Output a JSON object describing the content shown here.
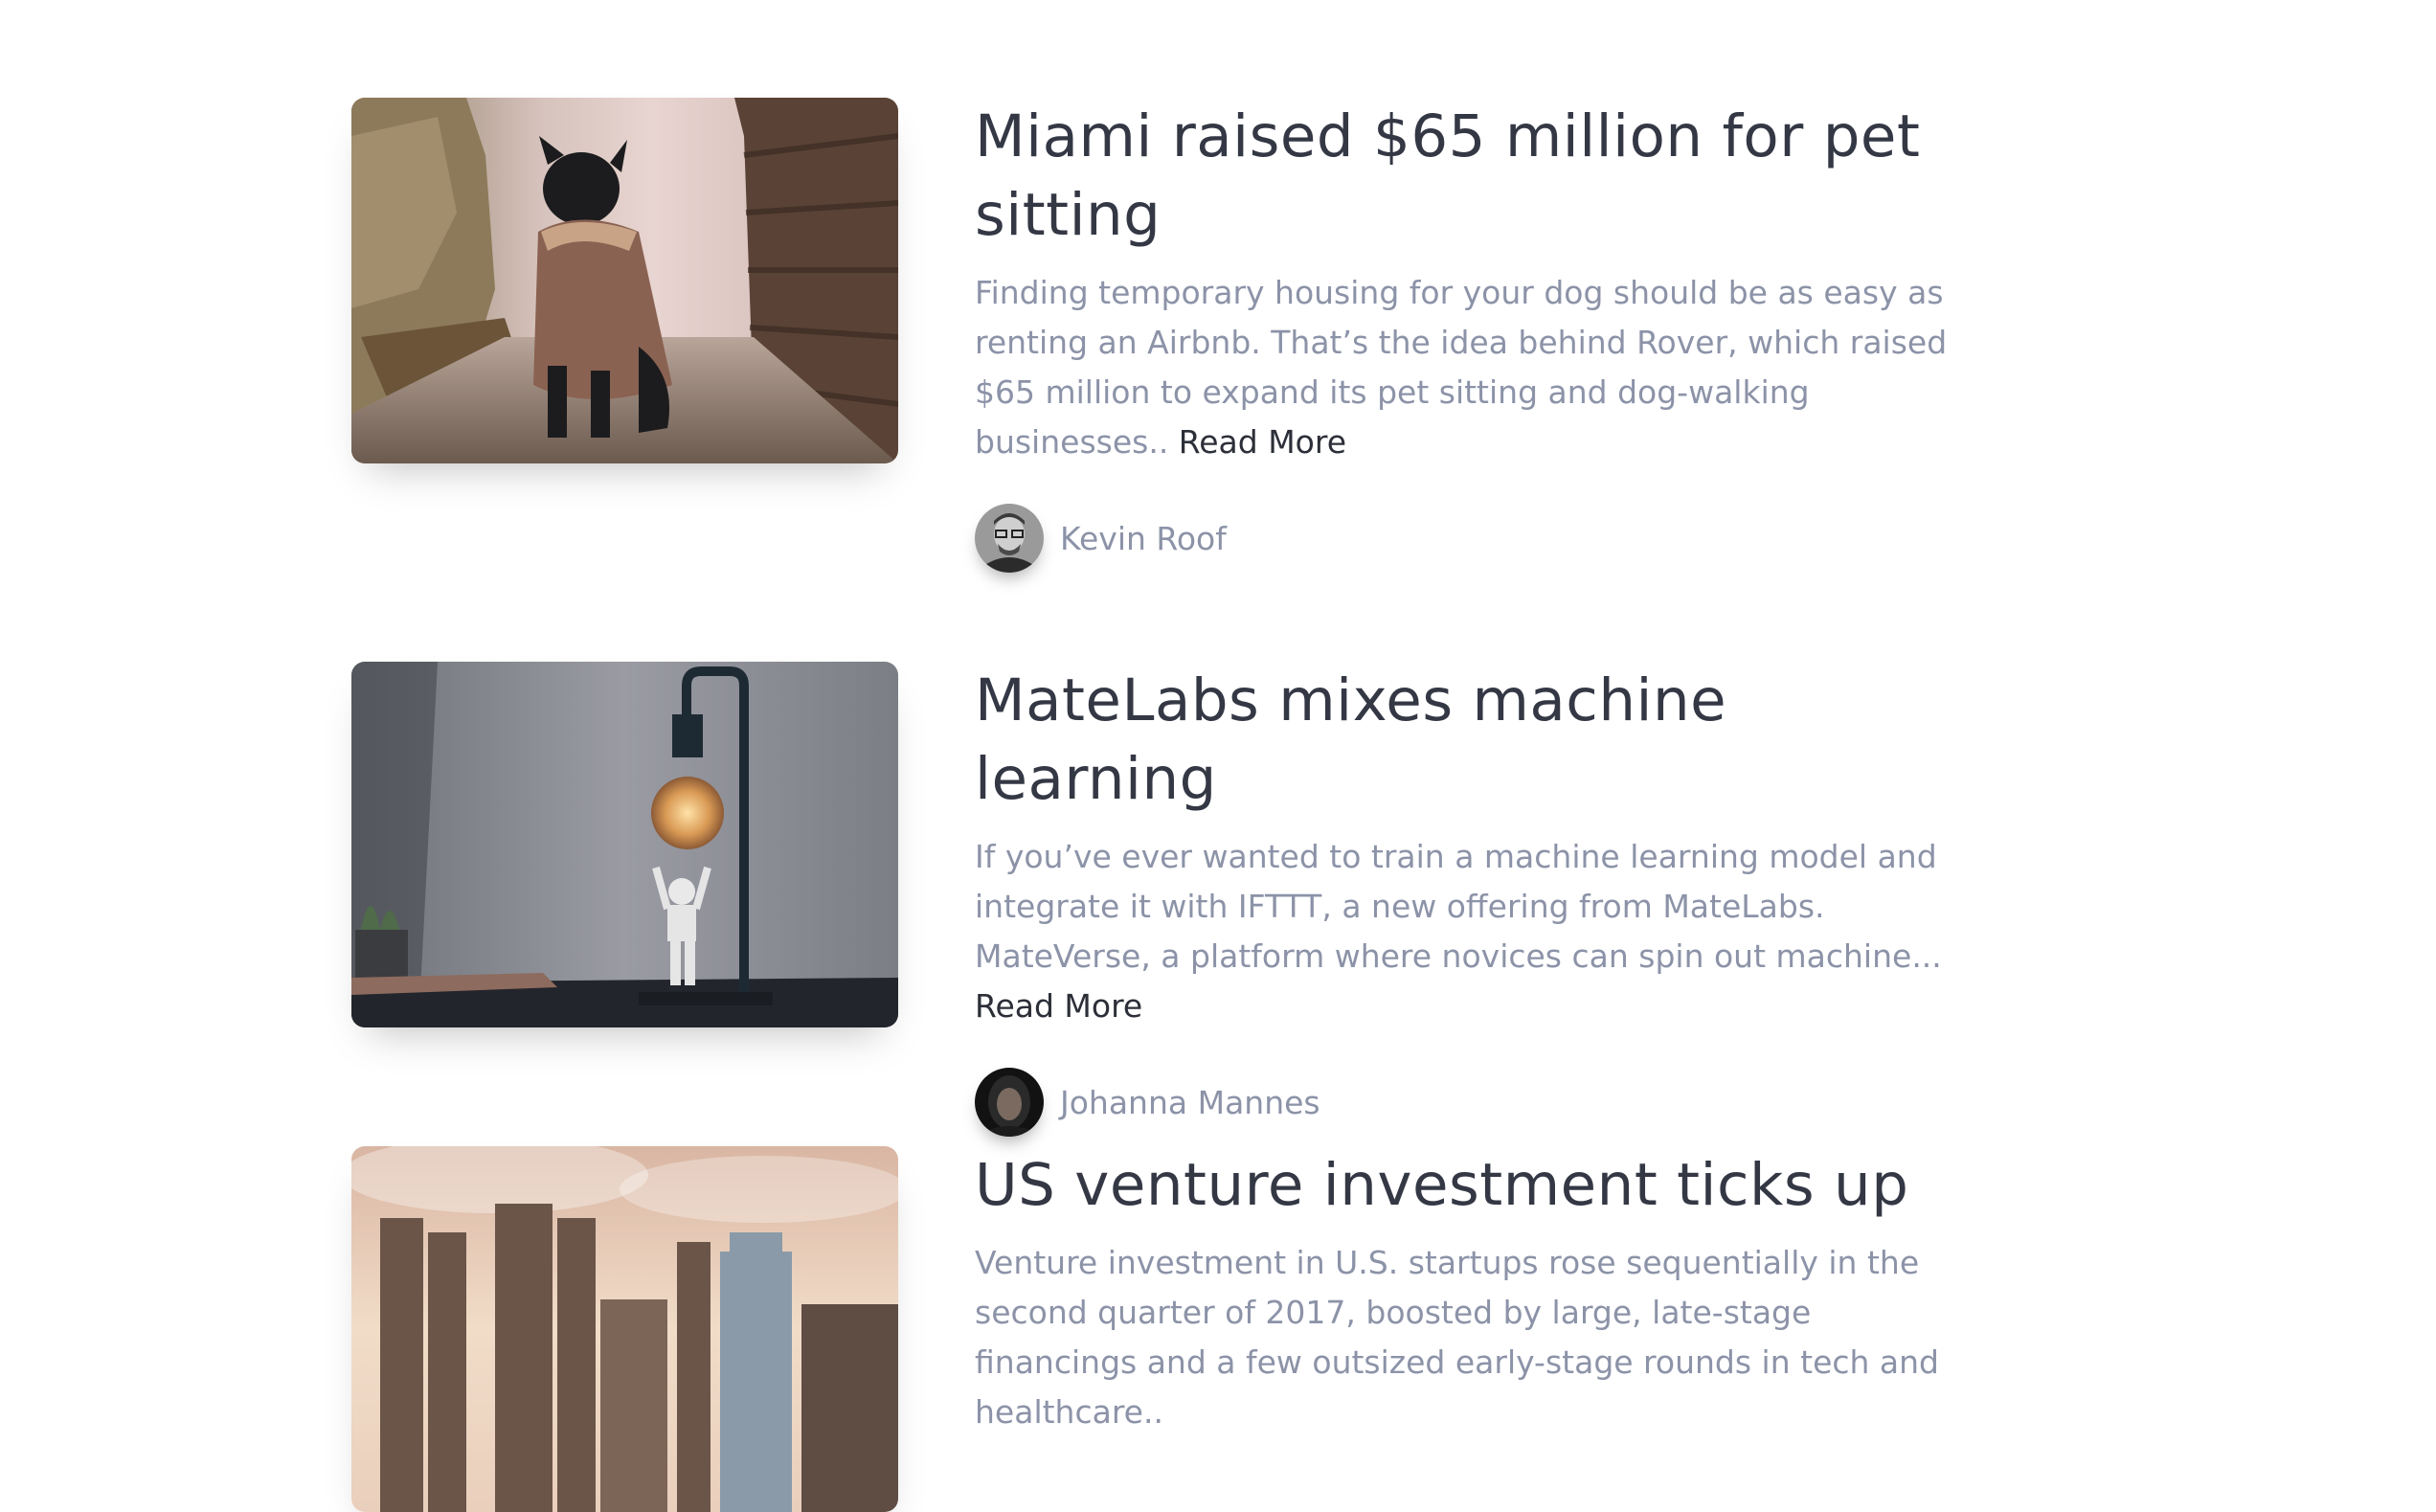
{
  "articles": [
    {
      "title": "Miami raised $65 million for pet sitting",
      "excerpt": "Finding temporary housing for your dog should be as easy as renting an Airbnb. That’s the idea behind Rover, which raised $65 million to expand its pet sitting and dog-walking businesses.. ",
      "read_more": "Read More",
      "author": "Kevin Roof",
      "image": "dog-in-jacket-photo",
      "avatar": "man-glasses-avatar"
    },
    {
      "title": "MateLabs mixes machine learning",
      "excerpt": "If you’ve ever wanted to train a machine learning model and integrate it with IFTTT, a new offering from MateLabs. MateVerse, a platform where novices can spin out machine... ",
      "read_more": "Read More",
      "author": "Johanna Mannes",
      "image": "lamp-stormtrooper-photo",
      "avatar": "woman-avatar"
    },
    {
      "title": "US venture investment ticks up",
      "excerpt": "Venture investment in U.S. startups rose sequentially in the second quarter of 2017, boosted by large, late-stage financings and a few outsized early-stage rounds in tech and healthcare..",
      "image": "city-skyline-photo"
    }
  ]
}
